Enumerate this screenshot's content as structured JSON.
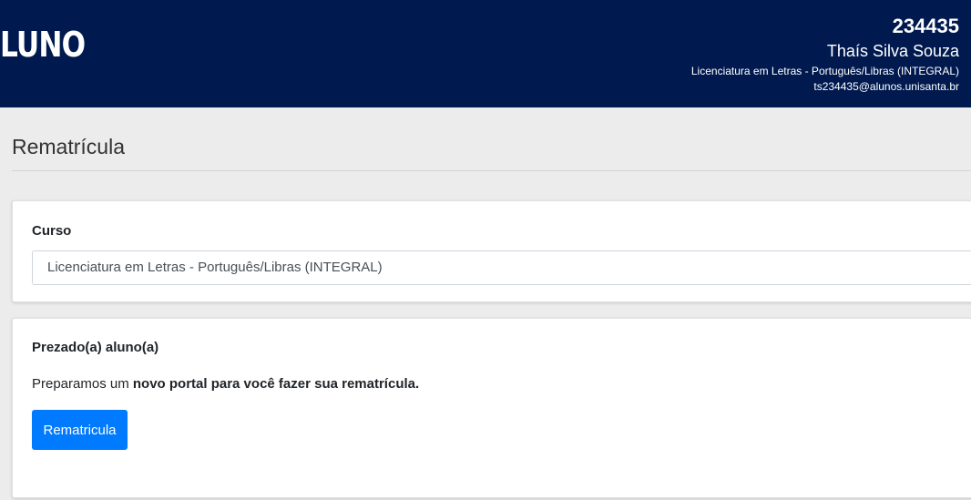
{
  "header": {
    "logo_text": "LUNO",
    "student_id": "234435",
    "student_name": "Thaís Silva Souza",
    "student_course": "Licenciatura em Letras - Português/Libras (INTEGRAL)",
    "student_email": "ts234435@alunos.unisanta.br",
    "background_color": "#001a4f"
  },
  "page": {
    "title": "Rematrícula"
  },
  "curso_card": {
    "label": "Curso",
    "selected_value": "Licenciatura em Letras - Português/Libras (INTEGRAL)"
  },
  "message_card": {
    "greeting": "Prezado(a) aluno(a)",
    "message_prefix": "Preparamos um ",
    "message_bold": "novo portal para você fazer sua rematrícula.",
    "button_label": "Rematricula",
    "button_color": "#007bff"
  }
}
